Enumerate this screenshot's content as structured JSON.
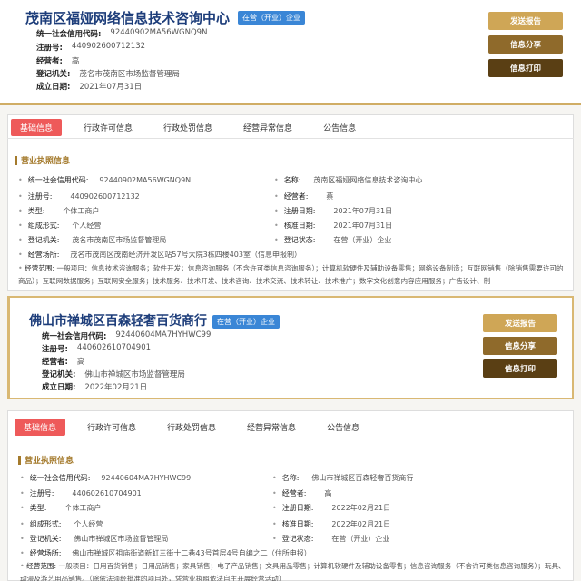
{
  "card1": {
    "name": "茂南区福娅网络信息技术咨询中心",
    "status": "在营（开业）企业",
    "credit_label": "统一社会信用代码:",
    "credit_val": "92440902MA56WGNQ9N",
    "regno_label": "注册号:",
    "regno_val": "440902600712132",
    "operator_label": "经营者:",
    "operator_val": "高",
    "authority_label": "登记机关:",
    "authority_val": "茂名市茂南区市场监督管理局",
    "date_label": "成立日期:",
    "date_val": "2021年07月31日",
    "btn_send": "发送报告",
    "btn_share": "信息分享",
    "btn_print": "信息打印",
    "tabs": [
      "基础信息",
      "行政许可信息",
      "行政处罚信息",
      "经营异常信息",
      "公告信息"
    ],
    "section": "营业执照信息",
    "rows": [
      {
        "l1": "统一社会信用代码:",
        "v1": "92440902MA56WGNQ9N",
        "l2": "名称:",
        "v2": "茂南区福娅网络信息技术咨询中心"
      },
      {
        "l1": "注册号:",
        "v1": "440902600712132",
        "l2": "经营者:",
        "v2": "蔡"
      },
      {
        "l1": "类型:",
        "v1": "个体工商户",
        "l2": "注册日期:",
        "v2": "2021年07月31日"
      },
      {
        "l1": "组成形式:",
        "v1": "个人经营",
        "l2": "核准日期:",
        "v2": "2021年07月31日"
      },
      {
        "l1": "登记机关:",
        "v1": "茂名市茂南区市场监督管理局",
        "l2": "登记状态:",
        "v2": "在营（开业）企业"
      }
    ],
    "place_label": "经营场所:",
    "place_val": "茂名市茂南区茂南经济开发区站57号大院3栋四楼403室（信息申报制）",
    "scope_label": "经营范围:",
    "scope_val": "一般项目：信息技术咨询服务；软件开发；信息咨询服务（不含许可类信息咨询服务）；计算机软硬件及辅助设备零售；网络设备制造；互联网销售（除销售需要许可的商品）；互联网数据服务；互联网安全服务；技术服务、技术开发、技术咨询、技术交流、技术转让、技术推广；数字文化创意内容应用服务；广告设计、制"
  },
  "card2": {
    "name": "佛山市禅城区百森轻奢百货商行",
    "status": "在营（开业）企业",
    "credit_label": "统一社会信用代码:",
    "credit_val": "92440604MA7HYHWC99",
    "regno_label": "注册号:",
    "regno_val": "440602610704901",
    "operator_label": "经营者:",
    "operator_val": "高",
    "authority_label": "登记机关:",
    "authority_val": "佛山市禅城区市场监督管理局",
    "date_label": "成立日期:",
    "date_val": "2022年02月21日",
    "btn_send": "发送报告",
    "btn_share": "信息分享",
    "btn_print": "信息打印",
    "tabs": [
      "基础信息",
      "行政许可信息",
      "行政处罚信息",
      "经营异常信息",
      "公告信息"
    ],
    "section": "营业执照信息",
    "rows": [
      {
        "l1": "统一社会信用代码:",
        "v1": "92440604MA7HYHWC99",
        "l2": "名称:",
        "v2": "佛山市禅城区百森轻奢百货商行"
      },
      {
        "l1": "注册号:",
        "v1": "440602610704901",
        "l2": "经营者:",
        "v2": "高"
      },
      {
        "l1": "类型:",
        "v1": "个体工商户",
        "l2": "注册日期:",
        "v2": "2022年02月21日"
      },
      {
        "l1": "组成形式:",
        "v1": "个人经营",
        "l2": "核准日期:",
        "v2": "2022年02月21日"
      },
      {
        "l1": "登记机关:",
        "v1": "佛山市禅城区市场监督管理局",
        "l2": "登记状态:",
        "v2": "在营（开业）企业"
      }
    ],
    "place_label": "经营场所:",
    "place_val": "佛山市禅城区祖庙街道新虹三街十二巷43号首层4号自编之二（住所申报）",
    "scope_label": "经营范围:",
    "scope_val": "一般项目：日用百货销售；日用品销售；家具销售；电子产品销售；文具用品零售；计算机软硬件及辅助设备零售；信息咨询服务（不含许可类信息咨询服务）；玩具、动漫及游艺用品销售。（除依法须经批准的项目外，凭营业执照依法自主开展经营活动）"
  }
}
